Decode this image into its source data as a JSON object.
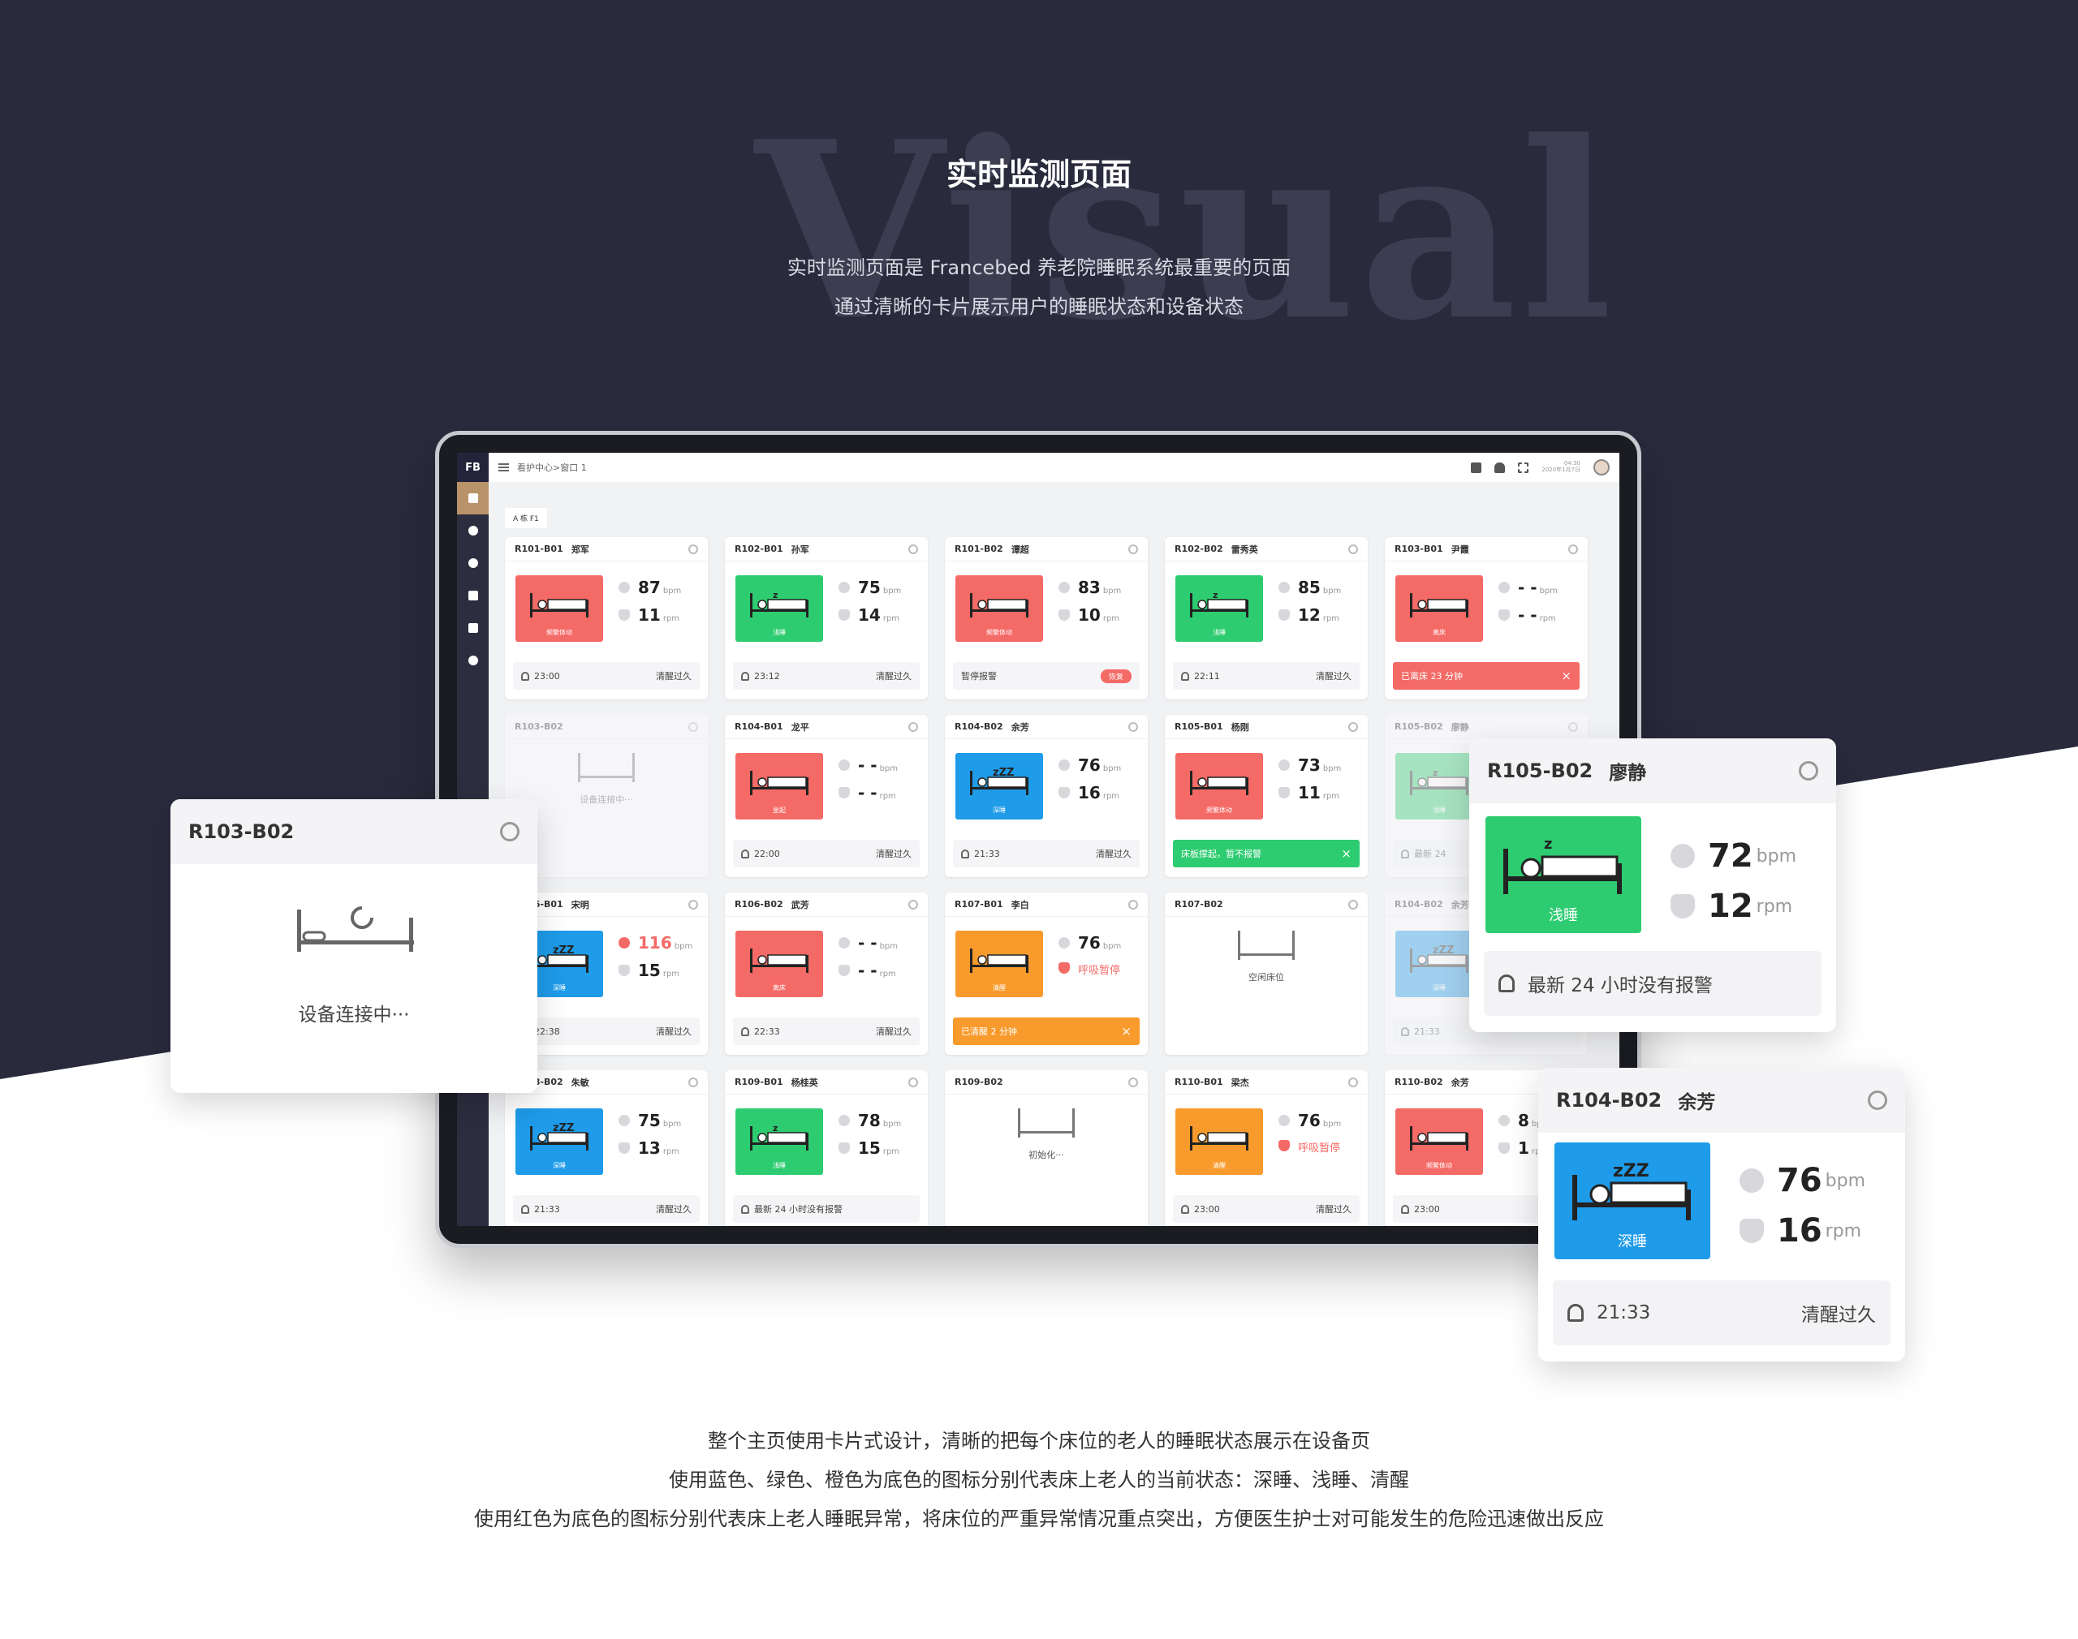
{
  "hero": {
    "watermark": "Visual",
    "title": "实时监测页面",
    "line1": "实时监测页面是 Francebed 养老院睡眠系统最重要的页面",
    "line2": "通过清晰的卡片展示用户的睡眠状态和设备状态"
  },
  "footer": {
    "line1": "整个主页使用卡片式设计，清晰的把每个床位的老人的睡眠状态展示在设备页",
    "line2": "使用蓝色、绿色、橙色为底色的图标分别代表床上老人的当前状态：深睡、浅睡、清醒",
    "line3": "使用红色为底色的图标分别代表床上老人睡眠异常，将床位的严重异常情况重点突出，方便医生护士对可能发生的危险迅速做出反应"
  },
  "colors": {
    "red": "#f46a66",
    "green": "#2ecc71",
    "blue": "#1e9be9",
    "orange": "#f89b2c"
  },
  "app": {
    "logo": "FB",
    "breadcrumb": "看护中心>窗口 1",
    "time": "04:30",
    "date": "2020年1月7日",
    "floor": "A 栋 F1",
    "icons": [
      "menu-icon",
      "phone-icon",
      "bell-icon",
      "fullscreen-icon",
      "avatar"
    ],
    "sidebar_icons": [
      "monitor-icon",
      "clock-icon",
      "user-icon",
      "document-icon",
      "report-icon",
      "settings-icon"
    ]
  },
  "units": {
    "hr": "bpm",
    "rr": "rpm"
  },
  "cards": [
    {
      "bed": "R101-B01",
      "name": "郑军",
      "color": "red",
      "state": "频繁体动",
      "hr": "87",
      "rr": "11",
      "foot_type": "time",
      "time": "23:00",
      "foot_right": "清醒过久"
    },
    {
      "bed": "R102-B01",
      "name": "孙军",
      "color": "green",
      "state": "浅睡",
      "hr": "75",
      "rr": "14",
      "foot_type": "time",
      "time": "23:12",
      "foot_right": "清醒过久"
    },
    {
      "bed": "R101-B02",
      "name": "谭超",
      "color": "red",
      "state": "频繁体动",
      "hr": "83",
      "rr": "10",
      "foot_type": "pause",
      "foot_text": "暂停报警",
      "pill": "恢复"
    },
    {
      "bed": "R102-B02",
      "name": "雷秀英",
      "color": "green",
      "state": "浅睡",
      "hr": "85",
      "rr": "12",
      "foot_type": "time",
      "time": "22:11",
      "foot_right": "清醒过久"
    },
    {
      "bed": "R103-B01",
      "name": "尹霞",
      "color": "red",
      "state": "离床",
      "hr": "- -",
      "rr": "- -",
      "foot_type": "alert",
      "alert_color": "red",
      "foot_text": "已离床 23 分钟"
    },
    {
      "bed": "R103-B02",
      "name": "",
      "empty": true,
      "dim": true,
      "empty_text": "设备连接中···"
    },
    {
      "bed": "R104-B01",
      "name": "龙平",
      "color": "red",
      "state": "坐起",
      "hr": "- -",
      "rr": "- -",
      "foot_type": "time",
      "time": "22:00",
      "foot_right": "清醒过久"
    },
    {
      "bed": "R104-B02",
      "name": "余芳",
      "color": "blue",
      "state": "深睡",
      "hr": "76",
      "rr": "16",
      "foot_type": "time",
      "time": "21:33",
      "foot_right": "清醒过久"
    },
    {
      "bed": "R105-B01",
      "name": "杨刚",
      "color": "red",
      "state": "频繁体动",
      "hr": "73",
      "rr": "11",
      "foot_type": "alert",
      "alert_color": "green",
      "foot_text": "床板撑起，暂不报警"
    },
    {
      "bed": "R105-B02",
      "name": "廖静",
      "color": "green",
      "state": "浅睡",
      "hr": "72",
      "rr": "12",
      "dim": true,
      "foot_type": "time",
      "time": "最新 24",
      "foot_right": ""
    },
    {
      "bed": "R106-B01",
      "name": "宋明",
      "color": "blue",
      "state": "深睡",
      "hr": "116",
      "hr_red": true,
      "rr": "15",
      "foot_type": "time",
      "time": "22:38",
      "foot_right": "清醒过久"
    },
    {
      "bed": "R106-B02",
      "name": "武芳",
      "color": "red",
      "state": "离床",
      "hr": "- -",
      "rr": "- -",
      "foot_type": "time",
      "time": "22:33",
      "foot_right": "清醒过久"
    },
    {
      "bed": "R107-B01",
      "name": "李白",
      "color": "orange",
      "state": "清醒",
      "hr": "76",
      "rr_warn": "呼吸暂停",
      "foot_type": "alert",
      "alert_color": "orange",
      "foot_text": "已清醒 2 分钟"
    },
    {
      "bed": "R107-B02",
      "name": "",
      "empty": true,
      "empty_text": "空闲床位"
    },
    {
      "bed": "R104-B02",
      "name": "余芳",
      "color": "blue",
      "state": "深睡",
      "hr": "76",
      "rr": "16",
      "dim": true,
      "foot_type": "time",
      "time": "21:33",
      "foot_right": ""
    },
    {
      "bed": "R108-B02",
      "name": "朱敏",
      "color": "blue",
      "state": "深睡",
      "hr": "75",
      "rr": "13",
      "foot_type": "time",
      "time": "21:33",
      "foot_right": "清醒过久"
    },
    {
      "bed": "R109-B01",
      "name": "杨桂英",
      "color": "green",
      "state": "浅睡",
      "hr": "78",
      "rr": "15",
      "foot_type": "time",
      "time": "最新 24 小时没有报警",
      "foot_right": ""
    },
    {
      "bed": "R109-B02",
      "name": "",
      "empty": true,
      "empty_text": "初始化···"
    },
    {
      "bed": "R110-B01",
      "name": "梁杰",
      "color": "orange",
      "state": "清醒",
      "hr": "76",
      "rr_warn": "呼吸暂停",
      "foot_type": "time",
      "time": "23:00",
      "foot_right": "清醒过久"
    },
    {
      "bed": "R110-B02",
      "name": "余芳",
      "color": "red",
      "state": "频繁体动",
      "hr": "8",
      "rr": "1",
      "foot_type": "time",
      "time": "23:00",
      "foot_right": ""
    }
  ],
  "float_connecting": {
    "bed": "R103-B02",
    "text": "设备连接中···"
  },
  "float_r105": {
    "bed": "R105-B02",
    "name": "廖静",
    "state": "浅睡",
    "hr": "72",
    "rr": "12",
    "foot": "最新 24 小时没有报警"
  },
  "float_r104": {
    "bed": "R104-B02",
    "name": "余芳",
    "state": "深睡",
    "hr": "76",
    "rr": "16",
    "time": "21:33",
    "foot_right": "清醒过久"
  }
}
